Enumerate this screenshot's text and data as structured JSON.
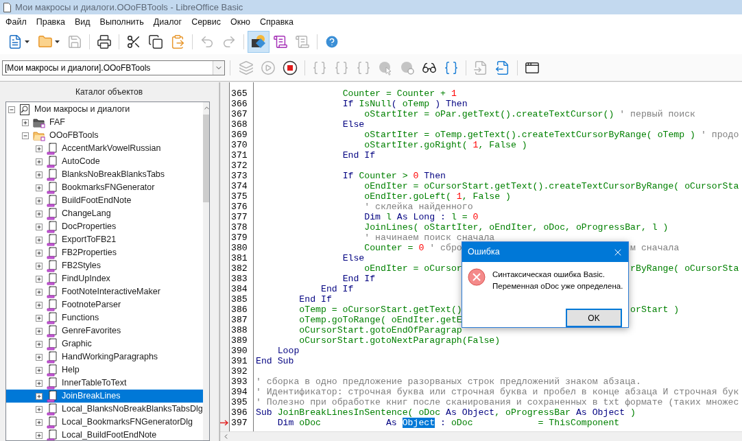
{
  "window": {
    "title": "Мои макросы и диалоги.OOoFBTools - LibreOffice Basic"
  },
  "menu": [
    "Файл",
    "Правка",
    "Вид",
    "Выполнить",
    "Диалог",
    "Сервис",
    "Окно",
    "Справка"
  ],
  "toolbar1": [
    [
      {
        "disabled": false,
        "selected": false
      },
      {
        "disabled": false,
        "selected": false
      },
      {
        "disabled": true,
        "selected": false
      }
    ],
    [
      {
        "disabled": false,
        "selected": false
      }
    ],
    [
      {
        "disabled": false,
        "selected": false
      },
      {
        "disabled": false,
        "selected": false
      },
      {
        "disabled": false,
        "selected": false
      }
    ],
    [
      {
        "disabled": true,
        "selected": false
      },
      {
        "disabled": true,
        "selected": false
      }
    ],
    [
      {
        "disabled": false,
        "selected": true
      },
      {
        "disabled": false,
        "selected": false
      },
      {
        "disabled": true,
        "selected": false
      }
    ],
    [
      {
        "disabled": false,
        "selected": false
      }
    ]
  ],
  "library_select": {
    "value": "[Мои макросы и диалоги].OOoFBTools"
  },
  "toolbar2": [
    [
      {
        "disabled": true
      },
      {
        "disabled": true
      },
      {
        "disabled": false
      }
    ],
    [
      {
        "disabled": true
      },
      {
        "disabled": true
      },
      {
        "disabled": true
      },
      {
        "disabled": true
      },
      {
        "disabled": true
      },
      {
        "disabled": false
      },
      {
        "disabled": false
      }
    ],
    [
      {
        "disabled": true
      },
      {
        "disabled": false
      }
    ],
    [
      {
        "disabled": false
      }
    ]
  ],
  "catalog": {
    "title": "Каталог объектов",
    "tree": [
      {
        "label": "Мои макросы и диалоги",
        "kind": "root",
        "expanded": true,
        "selected": false,
        "children": [
          {
            "label": "FAF",
            "kind": "library",
            "expanded": false,
            "selected": false
          },
          {
            "label": "OOoFBTools",
            "kind": "library",
            "expanded": true,
            "selected": false,
            "children": [
              {
                "label": "AccentMarkVowelRussian",
                "kind": "module",
                "expanded": false,
                "selected": false
              },
              {
                "label": "AutoCode",
                "kind": "module",
                "expanded": false,
                "selected": false
              },
              {
                "label": "BlanksNoBreakBlanksTabs",
                "kind": "module",
                "expanded": false,
                "selected": false
              },
              {
                "label": "BookmarksFNGenerator",
                "kind": "module",
                "expanded": false,
                "selected": false
              },
              {
                "label": "BuildFootEndNote",
                "kind": "module",
                "expanded": false,
                "selected": false
              },
              {
                "label": "ChangeLang",
                "kind": "module",
                "expanded": false,
                "selected": false
              },
              {
                "label": "DocProperties",
                "kind": "module",
                "expanded": false,
                "selected": false
              },
              {
                "label": "ExportToFB21",
                "kind": "module",
                "expanded": false,
                "selected": false
              },
              {
                "label": "FB2Properties",
                "kind": "module",
                "expanded": false,
                "selected": false
              },
              {
                "label": "FB2Styles",
                "kind": "module",
                "expanded": false,
                "selected": false
              },
              {
                "label": "FindUpIndex",
                "kind": "module",
                "expanded": false,
                "selected": false
              },
              {
                "label": "FootNoteInteractiveMaker",
                "kind": "module",
                "expanded": false,
                "selected": false
              },
              {
                "label": "FootnoteParser",
                "kind": "module",
                "expanded": false,
                "selected": false
              },
              {
                "label": "Functions",
                "kind": "module",
                "expanded": false,
                "selected": false
              },
              {
                "label": "GenreFavorites",
                "kind": "module",
                "expanded": false,
                "selected": false
              },
              {
                "label": "Graphic",
                "kind": "module",
                "expanded": false,
                "selected": false
              },
              {
                "label": "HandWorkingParagraphs",
                "kind": "module",
                "expanded": false,
                "selected": false
              },
              {
                "label": "Help",
                "kind": "module",
                "expanded": false,
                "selected": false
              },
              {
                "label": "InnerTableToText",
                "kind": "module",
                "expanded": false,
                "selected": false
              },
              {
                "label": "JoinBreakLines",
                "kind": "module",
                "expanded": false,
                "selected": true
              },
              {
                "label": "Local_BlanksNoBreakBlanksTabsDlg",
                "kind": "module",
                "expanded": false,
                "selected": false
              },
              {
                "label": "Local_BookmarksFNGeneratorDlg",
                "kind": "module",
                "expanded": false,
                "selected": false
              },
              {
                "label": "Local_BuildFootEndNote",
                "kind": "module",
                "expanded": false,
                "selected": false
              }
            ]
          }
        ]
      }
    ]
  },
  "editor": {
    "lines": [
      {
        "n": "365",
        "arrow": false,
        "segments": [
          [
            {
              "text": "                Counter = Counter + ",
              "kind": "id"
            },
            {
              "text": "1",
              "kind": "num"
            }
          ]
        ]
      },
      {
        "n": "366",
        "arrow": false,
        "segments": [
          [
            {
              "text": "                If ",
              "kind": "kw"
            },
            {
              "text": "IsNull",
              "kind": "id"
            },
            {
              "text": "( ",
              "kind": "op"
            },
            {
              "text": "oTemp",
              "kind": "id"
            },
            {
              "text": " ) Then",
              "kind": "kw"
            }
          ]
        ]
      },
      {
        "n": "367",
        "arrow": false,
        "segments": [
          [
            {
              "text": "                    oStartIter = oPar.getText().createTextCursor() ",
              "kind": "id"
            },
            {
              "text": "' первый поиск",
              "kind": "com"
            }
          ]
        ]
      },
      {
        "n": "368",
        "arrow": false,
        "segments": [
          [
            {
              "text": "                Else",
              "kind": "kw"
            }
          ]
        ]
      },
      {
        "n": "369",
        "arrow": false,
        "segments": [
          [
            {
              "text": "                    oStartIter = oTemp.getText().createTextCursorByRange( oTemp ) ",
              "kind": "id"
            },
            {
              "text": "' продо",
              "kind": "com"
            }
          ]
        ]
      },
      {
        "n": "370",
        "arrow": false,
        "segments": [
          [
            {
              "text": "                    oStartIter.goRight( ",
              "kind": "id"
            },
            {
              "text": "1",
              "kind": "num"
            },
            {
              "text": ", False )",
              "kind": "id"
            }
          ]
        ]
      },
      {
        "n": "371",
        "arrow": false,
        "segments": [
          [
            {
              "text": "                End If",
              "kind": "kw"
            }
          ]
        ]
      },
      {
        "n": "372",
        "arrow": false
      },
      {
        "n": "373",
        "arrow": false,
        "segments": [
          [
            {
              "text": "                If ",
              "kind": "kw"
            },
            {
              "text": "Counter > ",
              "kind": "id"
            },
            {
              "text": "0",
              "kind": "num"
            },
            {
              "text": " Then",
              "kind": "kw"
            }
          ]
        ]
      },
      {
        "n": "374",
        "arrow": false,
        "segments": [
          [
            {
              "text": "                    oEndIter = oCursorStart.getText().createTextCursorByRange( oCursorSta",
              "kind": "id"
            }
          ]
        ]
      },
      {
        "n": "375",
        "arrow": false,
        "segments": [
          [
            {
              "text": "                    oEndIter.goLeft( ",
              "kind": "id"
            },
            {
              "text": "1",
              "kind": "num"
            },
            {
              "text": ", False )",
              "kind": "id"
            }
          ]
        ]
      },
      {
        "n": "376",
        "arrow": false,
        "segments": [
          [
            {
              "text": "                    ' склейка найденного",
              "kind": "com"
            }
          ]
        ]
      },
      {
        "n": "377",
        "arrow": false,
        "segments": [
          [
            {
              "text": "                    Dim ",
              "kind": "kw"
            },
            {
              "text": "l ",
              "kind": "id"
            },
            {
              "text": "As Long : ",
              "kind": "kw"
            },
            {
              "text": "l = ",
              "kind": "id"
            },
            {
              "text": "0",
              "kind": "num"
            }
          ]
        ]
      },
      {
        "n": "378",
        "arrow": false,
        "segments": [
          [
            {
              "text": "                    JoinLines( oStartIter, oEndIter, oDoc, oProgressBar, l )",
              "kind": "id"
            }
          ]
        ]
      },
      {
        "n": "379",
        "arrow": false,
        "segments": [
          [
            {
              "text": "                    ' начинаем поиск сначала",
              "kind": "com"
            }
          ]
        ]
      },
      {
        "n": "380",
        "arrow": false,
        "segments": [
          [
            {
              "text": "                    Counter = ",
              "kind": "id"
            },
            {
              "text": "0",
              "kind": "num"
            },
            {
              "text": " ' сбро",
              "kind": "com"
            }
          ],
          [
            {
              "text": "                               м сначала",
              "kind": "com"
            }
          ]
        ]
      },
      {
        "n": "381",
        "arrow": false,
        "segments": [
          [
            {
              "text": "                Else",
              "kind": "kw"
            }
          ]
        ]
      },
      {
        "n": "382",
        "arrow": false,
        "segments": [
          [
            {
              "text": "                    oEndIter = oCursor",
              "kind": "id"
            }
          ],
          [
            {
              "text": "                               rByRange( oCursorSta",
              "kind": "id"
            }
          ]
        ]
      },
      {
        "n": "383",
        "arrow": false,
        "segments": [
          [
            {
              "text": "                End If",
              "kind": "kw"
            }
          ]
        ]
      },
      {
        "n": "384",
        "arrow": false,
        "segments": [
          [
            {
              "text": "            End If",
              "kind": "kw"
            }
          ]
        ]
      },
      {
        "n": "385",
        "arrow": false,
        "segments": [
          [
            {
              "text": "        End If",
              "kind": "kw"
            }
          ]
        ]
      },
      {
        "n": "386",
        "arrow": false,
        "segments": [
          [
            {
              "text": "        oTemp = oCursorStart.getText()",
              "kind": "id"
            }
          ],
          [
            {
              "text": "                               orStart )",
              "kind": "id"
            }
          ]
        ]
      },
      {
        "n": "387",
        "arrow": false,
        "segments": [
          [
            {
              "text": "        oTemp.goToRange( oEndIter.getE",
              "kind": "id"
            }
          ]
        ]
      },
      {
        "n": "388",
        "arrow": false,
        "segments": [
          [
            {
              "text": "        oCursorStart.gotoEndOfParagrap",
              "kind": "id"
            }
          ]
        ]
      },
      {
        "n": "389",
        "arrow": false,
        "segments": [
          [
            {
              "text": "        oCursorStart.gotoNextParagraph(False)",
              "kind": "id"
            }
          ]
        ]
      },
      {
        "n": "390",
        "arrow": false,
        "segments": [
          [
            {
              "text": "    Loop",
              "kind": "kw"
            }
          ]
        ]
      },
      {
        "n": "391",
        "arrow": false,
        "segments": [
          [
            {
              "text": "End Sub",
              "kind": "kw"
            }
          ]
        ]
      },
      {
        "n": "392",
        "arrow": false
      },
      {
        "n": "393",
        "arrow": false,
        "segments": [
          [
            {
              "text": "' сборка в одно предложение разорваных строк предложений знаком абзаца.",
              "kind": "com"
            }
          ]
        ]
      },
      {
        "n": "394",
        "arrow": false,
        "segments": [
          [
            {
              "text": "' Идентификатор: строчная буква или строчная буква и пробел в конце абзаца И строчная бук",
              "kind": "com"
            }
          ]
        ]
      },
      {
        "n": "395",
        "arrow": false,
        "segments": [
          [
            {
              "text": "' Полезно при обработке книг после сканирования и сохраненных в txt формате (таких множес",
              "kind": "com"
            }
          ]
        ]
      },
      {
        "n": "396",
        "arrow": false,
        "segments": [
          [
            {
              "text": "Sub ",
              "kind": "kw"
            },
            {
              "text": "JoinBreakLinesInSentence( oDoc ",
              "kind": "id"
            },
            {
              "text": "As Object",
              "kind": "kw"
            },
            {
              "text": ", oProgressBar ",
              "kind": "id"
            },
            {
              "text": "As Object",
              "kind": "kw"
            },
            {
              "text": " )",
              "kind": "id"
            }
          ]
        ]
      },
      {
        "n": "397",
        "arrow": true,
        "segments": [
          [
            {
              "text": "    Dim ",
              "kind": "kw"
            },
            {
              "text": "oDoc            ",
              "kind": "id"
            },
            {
              "text": "As ",
              "kind": "kw"
            },
            {
              "text": "Object",
              "kind": "sel"
            },
            {
              "text": " : ",
              "kind": "kw"
            },
            {
              "text": "oDoc            = ThisComponent",
              "kind": "id"
            }
          ]
        ]
      }
    ]
  },
  "dialog": {
    "title": "Ошибка",
    "messages": [
      "Синтаксическая ошибка Basic.",
      "Переменная oDoc уже определена."
    ],
    "button": "OK"
  }
}
